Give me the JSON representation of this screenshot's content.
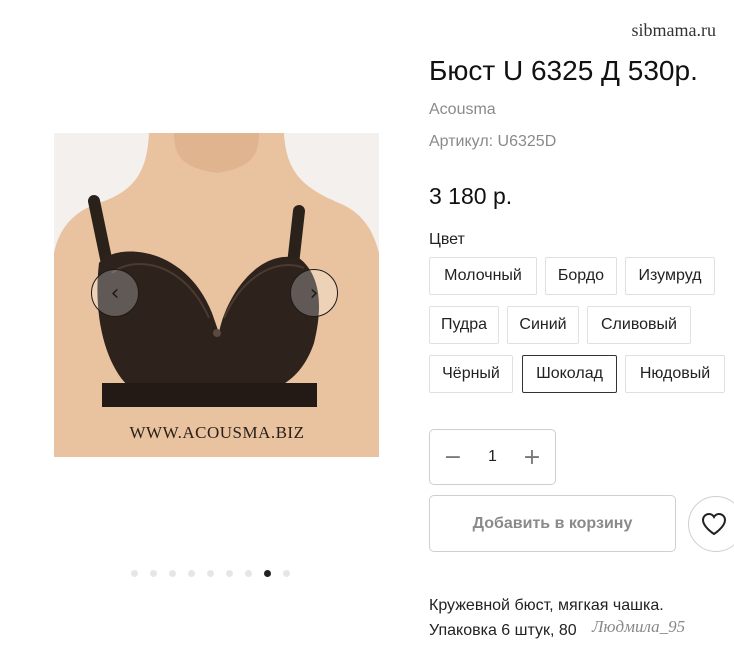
{
  "site_watermark": "sibmama.ru",
  "product": {
    "title": "Бюст U 6325 Д 530р.",
    "brand": "Acousma",
    "sku": "Артикул: U6325D",
    "price": "3 180 р."
  },
  "gallery": {
    "image_caption": "WWW.ACOUSMA.BIZ",
    "prev_icon": "chevron-left-icon",
    "next_icon": "chevron-right-icon",
    "dots_total": 9,
    "active_dot": 8
  },
  "colors": {
    "label": "Цвет",
    "options": [
      "Молочный",
      "Бордо",
      "Изумруд",
      "Пудра",
      "Синий",
      "Сливовый",
      "Чёрный",
      "Шоколад",
      "Нюдовый"
    ],
    "selected": "Шоколад"
  },
  "quantity": {
    "minus": "−",
    "value": "1",
    "plus": "+"
  },
  "actions": {
    "add_to_cart": "Добавить в корзину",
    "favorite_icon": "heart-icon"
  },
  "description": {
    "line1": "Кружевной бюст, мягкая чашка.",
    "line2": "Упаковка 6 штук, 80"
  },
  "user_watermark": "Людмила_95",
  "theme": {
    "accent": "#222222",
    "muted_text": "#8a8a8a",
    "border": "#e0e0e0"
  }
}
